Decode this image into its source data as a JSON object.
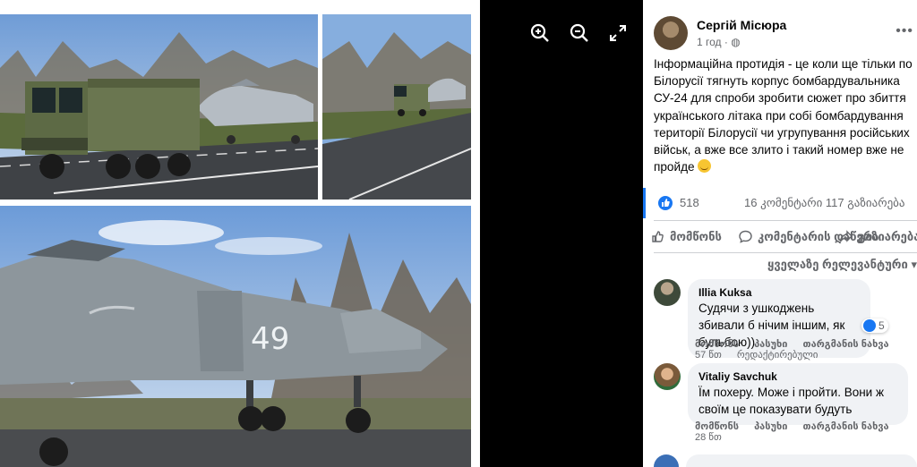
{
  "viewer": {
    "icons": [
      "zoom-in-icon",
      "zoom-out-icon",
      "fullscreen-icon"
    ],
    "tail_number": "49"
  },
  "post": {
    "author": "Сергій Місюра",
    "time": "1 год",
    "text": "Інформаційна протидія - це коли ще тільки по Білорусії тягнуть корпус бомбардувальника СУ-24 для спроби зробити сюжет про збиття українського літака при собі бомбардування території Білорусії чи угрупування російських військ, а вже все злито і такий номер вже не пройде",
    "reaction_count": "518",
    "comments_shares": "16 კომენტარი  117 გაზიარება"
  },
  "actions": {
    "like": "მომწონს",
    "comment": "კომენტარის დაწერა",
    "share": "გაზიარება"
  },
  "sort_label": "ყველაზე რელევანტური",
  "comments": [
    {
      "name": "Illia Kuksa",
      "text": "Судячи з ушкоджень збивали б нічим іншим, як бульбою))",
      "reactions": "5",
      "actions": [
        "მომწონს",
        "პასუხი",
        "თარგმანის ნახვა"
      ],
      "meta": [
        "57 წთ",
        "რედაქტირებული"
      ]
    },
    {
      "name": "Vitaliy Savchuk",
      "text": "Їм похеру. Може і пройти. Вони ж своїм це показувати будуть",
      "actions": [
        "მომწონს",
        "პასუხი",
        "თარგმანის ნახვა"
      ],
      "meta": [
        "28 წთ"
      ]
    }
  ],
  "colors": {
    "accent": "#1877f2",
    "bubble": "#f0f2f5",
    "muted": "#65676b"
  }
}
